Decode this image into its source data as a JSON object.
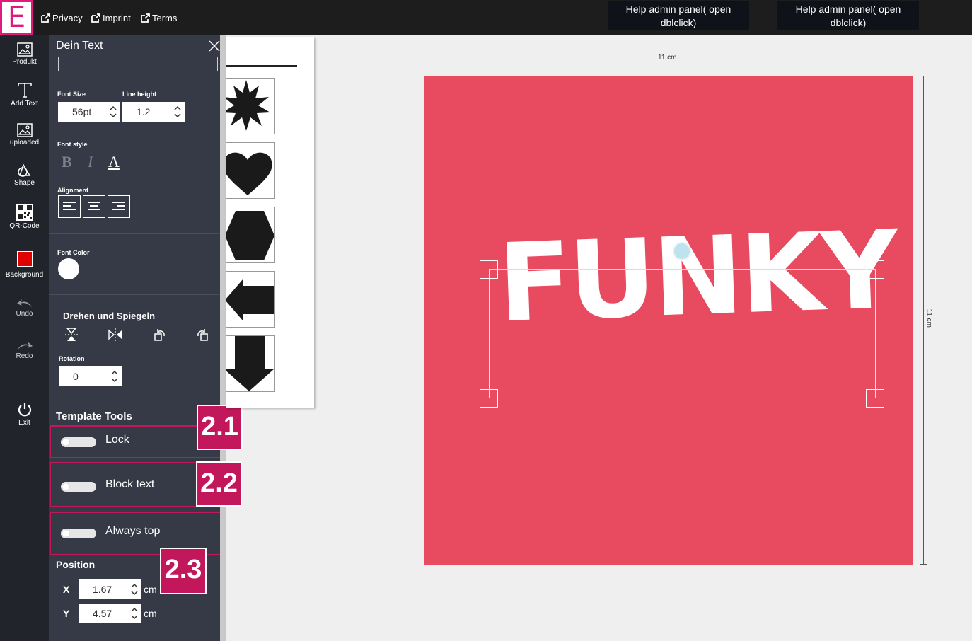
{
  "topbar": {
    "logo_letter": "E",
    "links": [
      "Privacy",
      "Imprint",
      "Terms"
    ],
    "help_buttons": [
      "Help admin panel( open dblclick)",
      "Help admin panel( open dblclick)"
    ]
  },
  "rail": {
    "items": [
      "Produkt",
      "Add Text",
      "uploaded",
      "Shape",
      "QR-Code",
      "Background",
      "Undo",
      "Redo",
      "Exit"
    ],
    "background_color": "#e00000"
  },
  "panel": {
    "title": "Dein Text",
    "font_size_label": "Font Size",
    "font_size_value": "56pt",
    "line_height_label": "Line height",
    "line_height_value": "1.2",
    "font_style_label": "Font style",
    "font_style_buttons": [
      "B",
      "I",
      "A"
    ],
    "alignment_label": "Alignment",
    "font_color_label": "Font Color",
    "font_color": "#ffffff",
    "rotate_title": "Drehen und Spiegeln",
    "rotation_label": "Rotation",
    "rotation_value": "0",
    "template_tools_title": "Template Tools",
    "toggles": [
      {
        "label": "Lock",
        "badge": "2.1"
      },
      {
        "label": "Block text",
        "badge": "2.2"
      },
      {
        "label": "Always top",
        "badge": "2.3"
      }
    ],
    "position_title": "Position",
    "x_label": "X",
    "x_value": "1.67",
    "y_label": "Y",
    "y_value": "4.57",
    "unit": "cm"
  },
  "shapes": [
    "star-shape",
    "heart-shape",
    "hexagon-shape",
    "arrow-left-shape",
    "arrow-down-shape"
  ],
  "canvas": {
    "width_label": "11 cm",
    "height_label": "11 cm",
    "artboard_color": "#e84a5f",
    "text": "FUNKY"
  }
}
